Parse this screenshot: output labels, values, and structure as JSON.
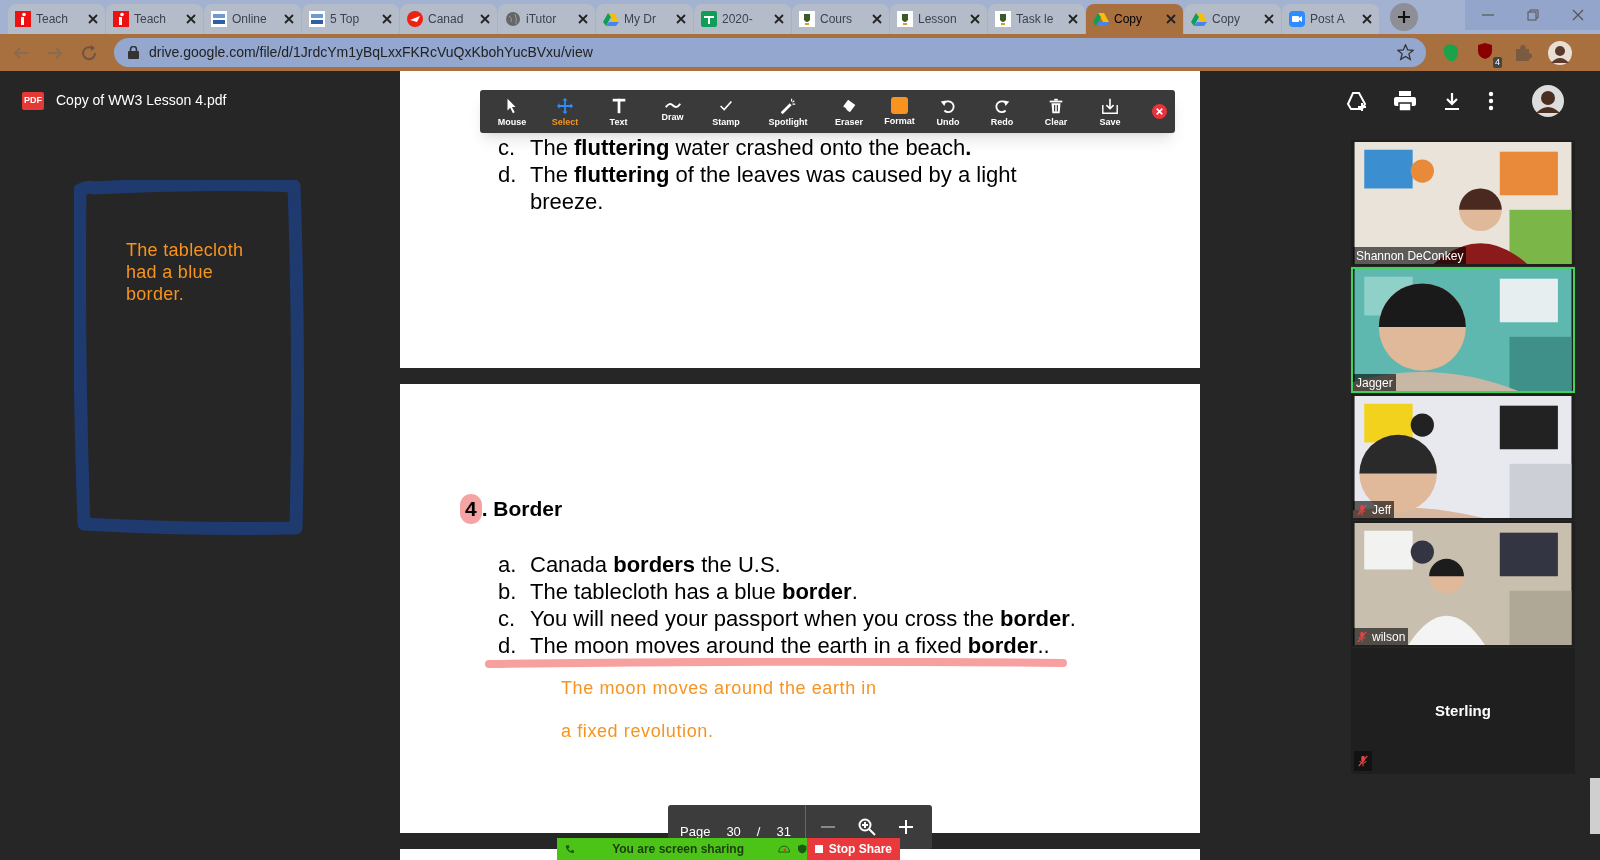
{
  "browser": {
    "tabs": [
      {
        "title": "Teach",
        "kind": "itutor",
        "selected": false
      },
      {
        "title": "Teach",
        "kind": "itutor",
        "selected": false
      },
      {
        "title": "Online",
        "kind": "jobs",
        "selected": false
      },
      {
        "title": "5 Top",
        "kind": "jobs",
        "selected": false
      },
      {
        "title": "Canad",
        "kind": "post",
        "selected": false
      },
      {
        "title": "iTutor",
        "kind": "globe",
        "selected": false
      },
      {
        "title": "My Dr",
        "kind": "drive",
        "selected": false
      },
      {
        "title": "2020-",
        "kind": "sheets",
        "selected": false
      },
      {
        "title": "Cours",
        "kind": "crest",
        "selected": false
      },
      {
        "title": "Lesson",
        "kind": "crest",
        "selected": false
      },
      {
        "title": "Task le",
        "kind": "crest",
        "selected": false
      },
      {
        "title": "Copy",
        "kind": "drive",
        "selected": true
      },
      {
        "title": "Copy",
        "kind": "drive",
        "selected": false
      },
      {
        "title": "Post A",
        "kind": "zoom",
        "selected": false
      }
    ],
    "address": "drive.google.com/file/d/1JrdcYm1yBqLxxFKRcVuQxKbohYucBVxu/view",
    "extension_badge": "4"
  },
  "viewer": {
    "file_badge": "PDF",
    "file_title": "Copy of WW3 Lesson 4.pdf"
  },
  "annotation_tools": [
    {
      "label": "Mouse",
      "kind": "mouse",
      "selected": false
    },
    {
      "label": "Select",
      "kind": "select",
      "selected": true
    },
    {
      "label": "Text",
      "kind": "text",
      "selected": false
    },
    {
      "label": "Draw",
      "kind": "draw",
      "selected": false
    },
    {
      "label": "Stamp",
      "kind": "stamp",
      "selected": false
    },
    {
      "label": "Spotlight",
      "kind": "spotlight",
      "selected": false
    },
    {
      "label": "Eraser",
      "kind": "eraser",
      "selected": false
    },
    {
      "label": "Format",
      "kind": "format",
      "selected": false,
      "color": "#f7931e"
    },
    {
      "label": "Undo",
      "kind": "undo",
      "selected": false
    },
    {
      "label": "Redo",
      "kind": "redo",
      "selected": false
    },
    {
      "label": "Clear",
      "kind": "clear",
      "selected": false
    },
    {
      "label": "Save",
      "kind": "save",
      "selected": false
    }
  ],
  "page_one": {
    "items": [
      {
        "marker": "c.",
        "lines": [
          "The **fluttering** water crashed onto the beach**.**"
        ]
      },
      {
        "marker": "d.",
        "lines": [
          "The **fluttering** of the leaves was caused by a light",
          "breeze."
        ]
      }
    ]
  },
  "page_two": {
    "number": "4",
    "heading": ". Border",
    "items": [
      {
        "marker": "a.",
        "text": "Canada **borders** the U.S."
      },
      {
        "marker": "b.",
        "text": "The tablecloth has a blue **border**."
      },
      {
        "marker": "c.",
        "text": "You will need your passport when you cross the **border**."
      },
      {
        "marker": "d.",
        "text": "The moon moves around the earth in a fixed **border**.."
      }
    ],
    "note_lines": [
      "The moon moves around the earth in",
      "a fixed revolution."
    ]
  },
  "side_note": {
    "lines": [
      "The tablecloth",
      "had a blue",
      "border."
    ]
  },
  "page_nav": {
    "label": "Page",
    "current": "30",
    "separator": "/",
    "total": "31"
  },
  "participants": [
    {
      "name": "Shannon DeConkey",
      "kind": "video",
      "muted": false,
      "speaking": false
    },
    {
      "name": "Jagger",
      "kind": "video",
      "muted": false,
      "speaking": true
    },
    {
      "name": "Jeff",
      "kind": "video",
      "muted": true,
      "speaking": false
    },
    {
      "name": "wilson",
      "kind": "video",
      "muted": true,
      "speaking": false
    },
    {
      "name": "Sterling",
      "kind": "name_only",
      "muted": true,
      "speaking": false
    }
  ],
  "share_bar": {
    "status": "You are screen sharing",
    "stop_button": "Stop Share"
  }
}
